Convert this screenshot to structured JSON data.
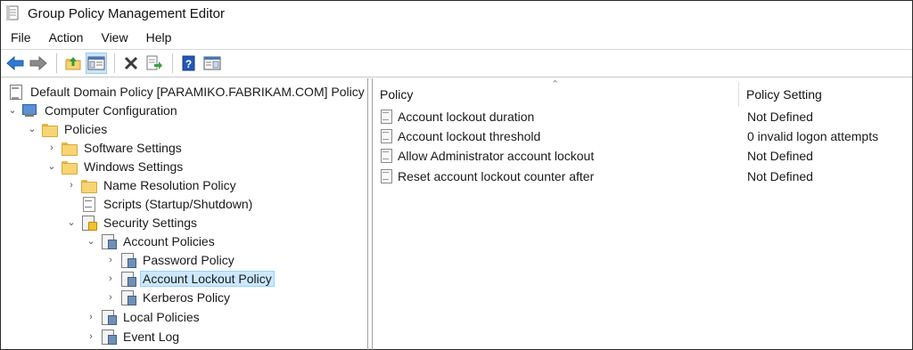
{
  "window": {
    "title": "Group Policy Management Editor"
  },
  "menubar": {
    "items": [
      "File",
      "Action",
      "View",
      "Help"
    ]
  },
  "toolbar": {
    "buttons": [
      "back-icon",
      "forward-icon",
      "up-folder-icon",
      "show-hide-tree-icon",
      "delete-icon",
      "export-list-icon",
      "help-icon",
      "properties-pane-icon"
    ]
  },
  "tree": {
    "root": "Default Domain Policy [PARAMIKO.FABRIKAM.COM] Policy",
    "computer_configuration": "Computer Configuration",
    "policies": "Policies",
    "software_settings": "Software Settings",
    "windows_settings": "Windows Settings",
    "name_resolution_policy": "Name Resolution Policy",
    "scripts": "Scripts (Startup/Shutdown)",
    "security_settings": "Security Settings",
    "account_policies": "Account Policies",
    "password_policy": "Password Policy",
    "account_lockout_policy": "Account Lockout Policy",
    "kerberos_policy": "Kerberos Policy",
    "local_policies": "Local Policies",
    "event_log": "Event Log"
  },
  "list": {
    "columns": {
      "policy": "Policy",
      "setting": "Policy Setting"
    },
    "rows": [
      {
        "policy": "Account lockout duration",
        "setting": "Not Defined"
      },
      {
        "policy": "Account lockout threshold",
        "setting": "0 invalid logon attempts"
      },
      {
        "policy": "Allow Administrator account lockout",
        "setting": "Not Defined"
      },
      {
        "policy": "Reset account lockout counter after",
        "setting": "Not Defined"
      }
    ]
  },
  "colors": {
    "selection": "#cce8ff",
    "selection_border": "#99d1ff",
    "toolbar_active": "#cce4f7"
  }
}
